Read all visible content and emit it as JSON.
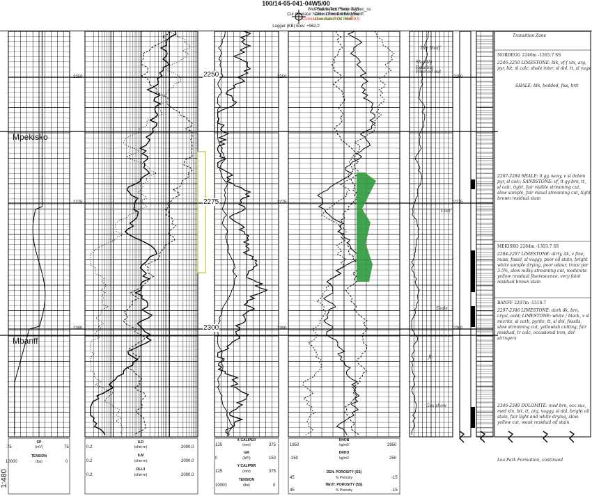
{
  "header": {
    "title": "100/14-05-041-04W5/00",
    "well_status": "Well Status Text: Susp GAS",
    "operator": "Cur Operator Name: Cenovus Enrg Inc",
    "gas_prod": "Cumulative Gas Prod: 46459.9",
    "prod_inject": "Prod./Inject. Frmtn: Kglauc_ss",
    "oldest_fm": "Oldest Frm Drilled: Mbanff",
    "oil_prod": "Cumulative Oil Prod:",
    "logger": "Logger (KB) Elev: +962.0",
    "gas_color": "#e8202a",
    "oil_color": "#1ea01e"
  },
  "formations": [
    "Mpekisko",
    "Mbanff"
  ],
  "depth_labels": [
    "2250",
    "2275",
    "2300"
  ],
  "track_depth_small": [
    "2250",
    "2275",
    "2300"
  ],
  "scale_label": "1:480",
  "track_headers": {
    "sp": {
      "name": "SP",
      "unit": "(mV)",
      "min": "-75",
      "max": "75"
    },
    "tension": {
      "name": "TENSION",
      "unit": "(lbs)",
      "min": "10000",
      "max": "0"
    },
    "ild": {
      "name": "ILD",
      "unit": "(ohm-m)",
      "min": "0.2",
      "max": "2000.0"
    },
    "ilm": {
      "name": "ILM",
      "unit": "(ohm-m)",
      "min": "0.2",
      "max": "2000.0"
    },
    "rll3": {
      "name": "RLL3",
      "unit": "(ohm-m)",
      "min": "0.2",
      "max": "2000.0"
    },
    "xcal": {
      "name": "X CALIPER",
      "unit": "(mm)",
      "min": "125",
      "max": "375"
    },
    "gr": {
      "name": "GR",
      "unit": "(API)",
      "min": "0",
      "max": "150"
    },
    "ycal": {
      "name": "Y CALIPER",
      "unit": "(mm)",
      "min": "125",
      "max": "375"
    },
    "tension2": {
      "name": "TENSION",
      "unit": "(lbs)",
      "min": "10000",
      "max": "0"
    },
    "rhob": {
      "name": "RHOB",
      "unit": "kg/m3",
      "min": "1950",
      "max": "2950"
    },
    "drho": {
      "name": "DRHO",
      "unit": "kg/m3",
      "min": "-250",
      "max": "250"
    },
    "dphi": {
      "name": "DEN. POROSITY (SS)",
      "unit": "% Porosity",
      "min": "45",
      "max": "-15"
    },
    "nphi": {
      "name": "NEUT. POROSITY (SS)",
      "unit": "% Porosity",
      "min": "45",
      "max": "-15"
    }
  },
  "lithology_notes": [
    "Transition Zone",
    "NORDEGG 2246m -1265.7 SS",
    "2246-2250 LIMESTONE: blk, vf-f xln, arg, pyr, bit; sl calc; shale inter, sl dol, tt, sl vugs",
    "SHALE: blk, bedded, fiss, brit",
    "2267-2284 SHALE: lt gy, waxy, v sl dolom pyr, sl calc; SANDSTONE: vf, lt gy-brn, tt, sl calc, tight, fair visible streaming cut, slow sample, fair visual streaming cut, tight brown residual stain",
    "MEKISKO 2284m -1303.7 SS",
    "2284-2297 LIMESTONE: dirty, dk, v fine, mass, fossil, sl vuggy, poor oil stain, bright white sample drying, poor odour, trace por 3-5%, slow milky streaming cut, moderate yellow residual fluorescence, very faint residual brown stain",
    "BANFF 2297m -1316.7",
    "2297-2346 LIMESTONE: dark dk, brn, cryxl, ooid; LIMESTONE: white / black, v sl micrite, sl carb, pyrite, tt, sl dol, fossils, slow streaming cut, yellowish cutting, fair residual, tr calc, occasional iron, dol stringers",
    "2346-2349 DOLOMITE: med brn, occ suc, med xln, bit, tt, arg, vuggy, sl dol, bright oil stain, fair light and white drying, slow yellow cut, weak residual oil stain",
    "Lea Park Formation, continued"
  ],
  "lith_depth_notes": [
    "The Shelf",
    "Slightly Reading",
    "Pinched out",
    "Coal",
    "Shale",
    "Jl.",
    "Gas show"
  ]
}
